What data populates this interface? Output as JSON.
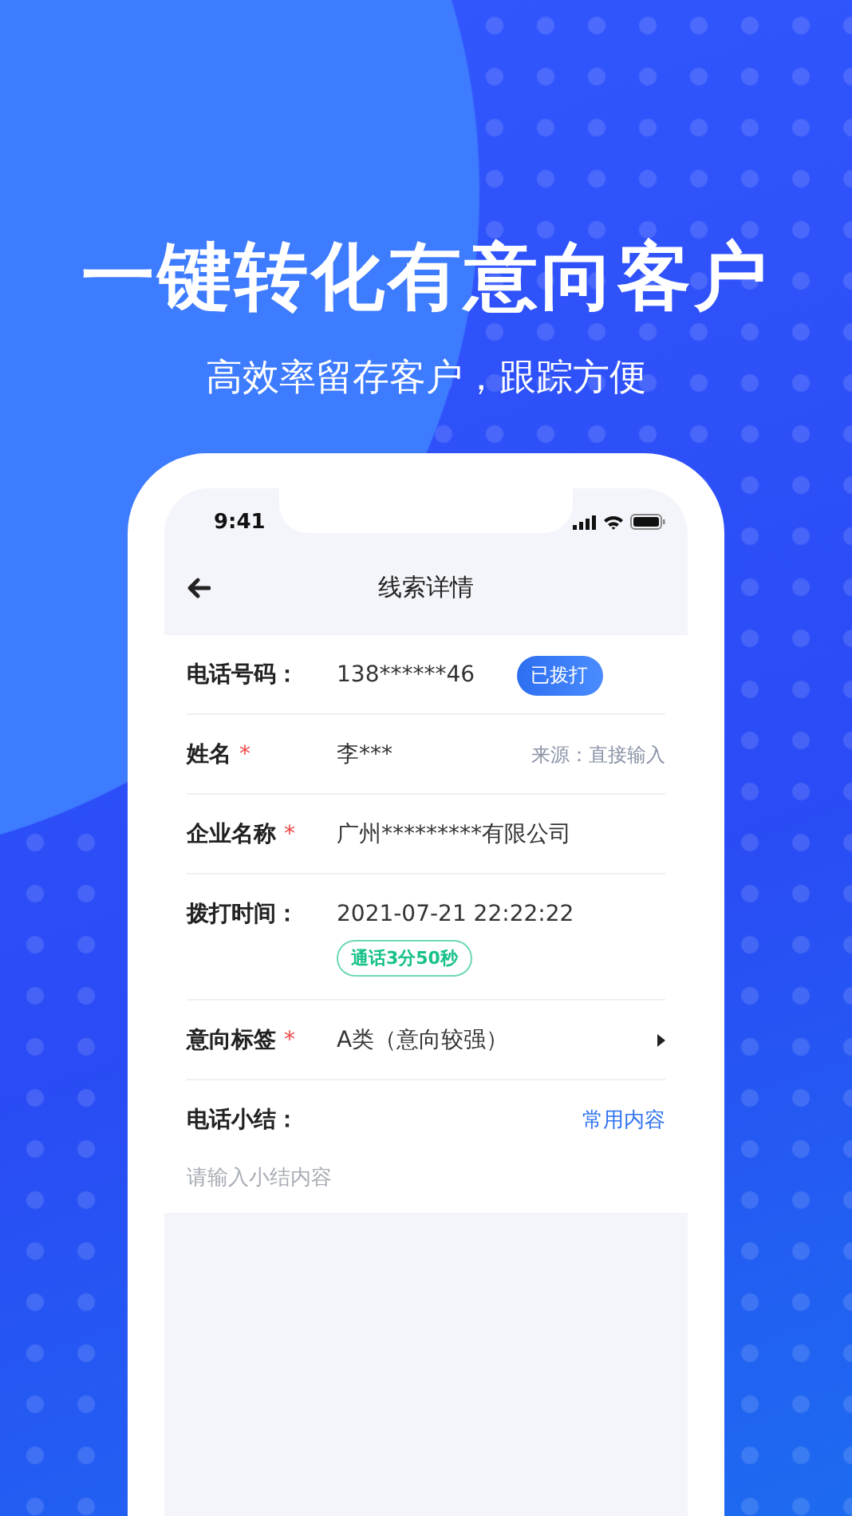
{
  "headline": "一键转化有意向客户",
  "subheadline": "高效率留存客户，跟踪方便",
  "status_bar": {
    "time": "9:41"
  },
  "nav": {
    "title": "线索详情"
  },
  "rows": [
    {
      "kind": "badge",
      "label": "电话号码：",
      "value": "138******46",
      "badge": "已拨打"
    },
    {
      "kind": "note",
      "label": "姓名",
      "required_mark": "*",
      "value": "李***",
      "note": "来源：直接输入"
    },
    {
      "kind": "plain",
      "label": "企业名称",
      "required_mark": "*",
      "value": "广州*********有限公司"
    },
    {
      "kind": "duration",
      "label": "拨打时间：",
      "value": "2021-07-21 22:22:22",
      "tag": "通话3分50秒"
    },
    {
      "kind": "select",
      "label": "意向标签",
      "required_mark": "*",
      "value": "A类（意向较强）"
    }
  ],
  "summary": {
    "label": "电话小结：",
    "link": "常用内容",
    "placeholder": "请输入小结内容"
  }
}
